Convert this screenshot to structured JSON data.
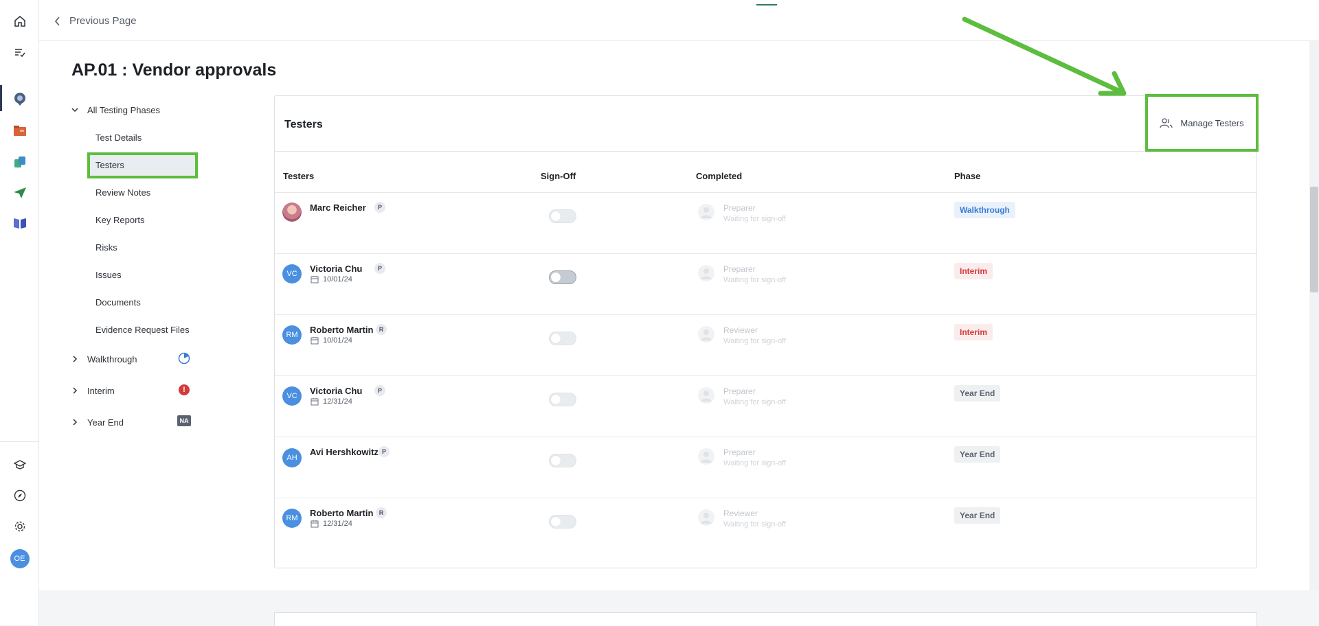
{
  "back": {
    "label": "Previous Page"
  },
  "page": {
    "title": "AP.01 : Vendor approvals"
  },
  "nav": {
    "group_label": "All Testing Phases",
    "items": [
      {
        "label": "Test Details"
      },
      {
        "label": "Testers"
      },
      {
        "label": "Review Notes"
      },
      {
        "label": "Key Reports"
      },
      {
        "label": "Risks"
      },
      {
        "label": "Issues"
      },
      {
        "label": "Documents"
      },
      {
        "label": "Evidence Request Files"
      }
    ],
    "phases": [
      {
        "label": "Walkthrough",
        "status_icon": "progress-icon"
      },
      {
        "label": "Interim",
        "status_icon": "alert-icon",
        "badge": "!"
      },
      {
        "label": "Year End",
        "status_icon": "na-badge",
        "badge": "NA"
      }
    ]
  },
  "card": {
    "title": "Testers",
    "manage_label": "Manage Testers",
    "columns": [
      "Testers",
      "Sign-Off",
      "Completed",
      "Phase"
    ],
    "rows": [
      {
        "name": "Marc Reicher",
        "role": "P",
        "initials": "",
        "date": "",
        "completed_role": "Preparer",
        "completed_status": "Waiting for sign-off",
        "phase": "Walkthrough"
      },
      {
        "name": "Victoria Chu",
        "role": "P",
        "initials": "VC",
        "date": "10/01/24",
        "completed_role": "Preparer",
        "completed_status": "Waiting for sign-off",
        "phase": "Interim"
      },
      {
        "name": "Roberto Martin",
        "role": "R",
        "initials": "RM",
        "date": "10/01/24",
        "completed_role": "Reviewer",
        "completed_status": "Waiting for sign-off",
        "phase": "Interim"
      },
      {
        "name": "Victoria Chu",
        "role": "P",
        "initials": "VC",
        "date": "12/31/24",
        "completed_role": "Preparer",
        "completed_status": "Waiting for sign-off",
        "phase": "Year End"
      },
      {
        "name": "Avi Hershkowitz",
        "role": "P",
        "initials": "AH",
        "date": "",
        "completed_role": "Preparer",
        "completed_status": "Waiting for sign-off",
        "phase": "Year End"
      },
      {
        "name": "Roberto Martin",
        "role": "R",
        "initials": "RM",
        "date": "12/31/24",
        "completed_role": "Reviewer",
        "completed_status": "Waiting for sign-off",
        "phase": "Year End"
      }
    ]
  },
  "user": {
    "initials": "OE"
  },
  "colors": {
    "highlight": "#5dbd3e",
    "avatar": "#4a8fe0",
    "walkthrough": "#3a7bd5",
    "interim": "#d03a3a"
  }
}
